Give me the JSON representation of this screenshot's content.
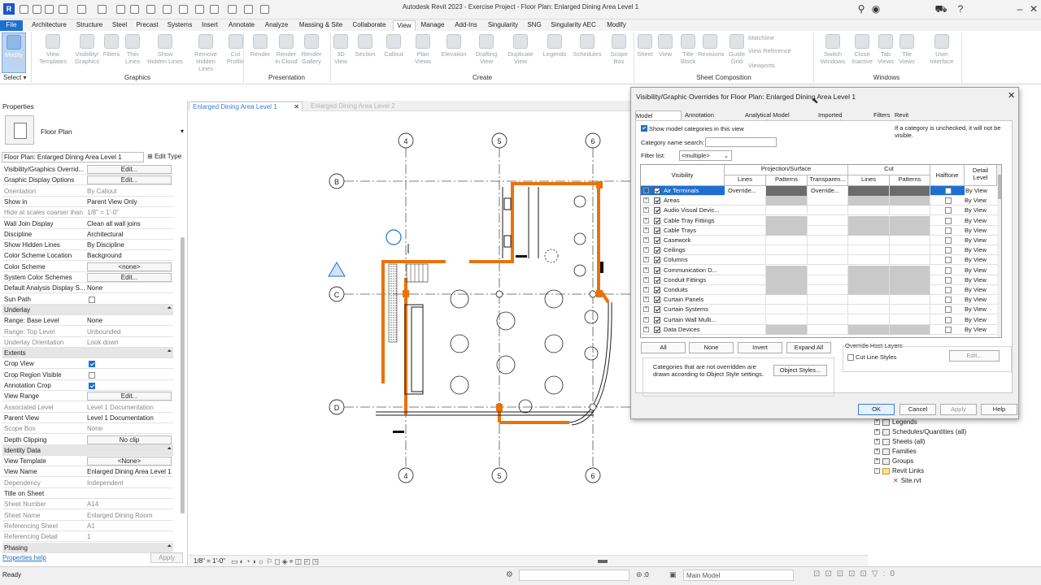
{
  "window": {
    "title": "Autodesk Revit 2023 - Exercise Project - Floor Plan: Enlarged Dining Area Level 1",
    "logo": "R"
  },
  "tabs": [
    "File",
    "Architecture",
    "Structure",
    "Steel",
    "Precast",
    "Systems",
    "Insert",
    "Annotate",
    "Analyze",
    "Massing & Site",
    "Collaborate",
    "View",
    "Manage",
    "Add-Ins",
    "Singularity",
    "SNG",
    "Singularity AEC",
    "Modify"
  ],
  "ribbon": {
    "buttons": [
      {
        "label": "Modify"
      },
      {
        "label": "View\nTemplates"
      },
      {
        "label": "Visibility/\nGraphics"
      },
      {
        "label": "Filters"
      },
      {
        "label": "Thin\nLines"
      },
      {
        "label": "Show\nHidden Lines"
      },
      {
        "label": "Remove\nHidden Lines"
      },
      {
        "label": "Cut\nProfile"
      },
      {
        "label": "Render"
      },
      {
        "label": "Render\nin Cloud"
      },
      {
        "label": "Render\nGallery"
      },
      {
        "label": "3D\nView"
      },
      {
        "label": "Section"
      },
      {
        "label": "Callout"
      },
      {
        "label": "Plan\nViews"
      },
      {
        "label": "Elevation"
      },
      {
        "label": "Drafting\nView"
      },
      {
        "label": "Duplicate\nView"
      },
      {
        "label": "Legends"
      },
      {
        "label": "Schedules"
      },
      {
        "label": "Scope\nBox"
      },
      {
        "label": "Sheet"
      },
      {
        "label": "View"
      },
      {
        "label": "Title\nBlock"
      },
      {
        "label": "Revisions"
      },
      {
        "label": "Guide\nGrid"
      },
      {
        "label": "Switch\nWindows"
      },
      {
        "label": "Close\nInactive"
      },
      {
        "label": "Tab\nViews"
      },
      {
        "label": "Tile\nViews"
      },
      {
        "label": "User\nInterface"
      }
    ],
    "small": [
      "Matchline",
      "View Reference",
      "Viewports"
    ],
    "groups": [
      "Select ▾",
      "Graphics",
      "Presentation",
      "Create",
      "Sheet Composition",
      "Windows"
    ]
  },
  "properties": {
    "header": "Properties",
    "type": "Floor Plan",
    "instance": "Floor Plan: Enlarged Dining Area Level 1",
    "edit_type": "Edit Type",
    "rows": [
      {
        "k": "Visibility/Graphics Overrid...",
        "v": "Edit...",
        "t": "btn"
      },
      {
        "k": "Graphic Display Options",
        "v": "Edit...",
        "t": "btn"
      },
      {
        "k": "Orientation",
        "v": "By Callout",
        "t": "gray"
      },
      {
        "k": "Show in",
        "v": "Parent View Only"
      },
      {
        "k": "Hide at scales coarser than",
        "v": "1/8\" = 1'-0\"",
        "t": "gray"
      },
      {
        "k": "Wall Join Display",
        "v": "Clean all wall joins"
      },
      {
        "k": "Discipline",
        "v": "Architectural"
      },
      {
        "k": "Show Hidden Lines",
        "v": "By Discipline"
      },
      {
        "k": "Color Scheme Location",
        "v": "Background"
      },
      {
        "k": "Color Scheme",
        "v": "<none>",
        "t": "btn"
      },
      {
        "k": "System Color Schemes",
        "v": "Edit...",
        "t": "btn"
      },
      {
        "k": "Default Analysis Display S...",
        "v": "None"
      },
      {
        "k": "Sun Path",
        "v": "",
        "t": "cb"
      },
      {
        "k": "Underlay",
        "v": "",
        "t": "sec"
      },
      {
        "k": "Range: Base Level",
        "v": "None"
      },
      {
        "k": "Range: Top Level",
        "v": "Unbounded",
        "t": "gray"
      },
      {
        "k": "Underlay Orientation",
        "v": "Look down",
        "t": "gray"
      },
      {
        "k": "Extents",
        "v": "",
        "t": "sec"
      },
      {
        "k": "Crop View",
        "v": "",
        "t": "cbon"
      },
      {
        "k": "Crop Region Visible",
        "v": "",
        "t": "cb"
      },
      {
        "k": "Annotation Crop",
        "v": "",
        "t": "cbon"
      },
      {
        "k": "View Range",
        "v": "Edit...",
        "t": "btn"
      },
      {
        "k": "Associated Level",
        "v": "Level 1 Documentation",
        "t": "gray"
      },
      {
        "k": "Parent View",
        "v": "Level 1 Documentation"
      },
      {
        "k": "Scope Box",
        "v": "None",
        "t": "gray"
      },
      {
        "k": "Depth Clipping",
        "v": "No clip",
        "t": "btn"
      },
      {
        "k": "Identity Data",
        "v": "",
        "t": "sec"
      },
      {
        "k": "View Template",
        "v": "<None>",
        "t": "btn"
      },
      {
        "k": "View Name",
        "v": "Enlarged Dining Area Level 1"
      },
      {
        "k": "Dependency",
        "v": "Independent",
        "t": "gray"
      },
      {
        "k": "Title on Sheet",
        "v": ""
      },
      {
        "k": "Sheet Number",
        "v": "A14",
        "t": "gray"
      },
      {
        "k": "Sheet Name",
        "v": "Enlarged Dining Room",
        "t": "gray"
      },
      {
        "k": "Referencing Sheet",
        "v": "A1",
        "t": "gray"
      },
      {
        "k": "Referencing Detail",
        "v": "1",
        "t": "gray"
      },
      {
        "k": "Phasing",
        "v": "",
        "t": "sec"
      }
    ],
    "help": "Properties help",
    "apply": "Apply"
  },
  "view_tabs": [
    "Enlarged Dining Area Level 1",
    "Enlarged Dining Area Level 2"
  ],
  "scale": "1/8\" = 1'-0\"",
  "grid": {
    "cols": [
      "4",
      "5",
      "6"
    ],
    "rows": [
      "B",
      "C",
      "D"
    ]
  },
  "browser": [
    "Legends",
    "Schedules/Quantities (all)",
    "Sheets (all)",
    "Families",
    "Groups",
    "Revit Links",
    "Site.rvt"
  ],
  "status": {
    "text": "Ready",
    "coord": ":0",
    "model": "Main Model"
  },
  "dialog": {
    "title": "Visibility/Graphic Overrides for Floor Plan: Enlarged Dining Area Level 1",
    "tabs": [
      "Model Categories",
      "Annotation Categories",
      "Analytical Model Categories",
      "Imported Categories",
      "Filters",
      "Revit Links"
    ],
    "show_label": "Show model categories in this view",
    "note": "If a category is unchecked, it will not be visible.",
    "search_label": "Category name search:",
    "filter_label": "Filter list:",
    "filter_value": "<multiple>",
    "headers": {
      "visibility": "Visibility",
      "proj": "Projection/Surface",
      "cut": "Cut",
      "lines": "Lines",
      "patterns": "Patterns",
      "transp": "Transparen...",
      "halftone": "Halftone",
      "detail": "Detail Level"
    },
    "rows": [
      "Air Terminals",
      "Areas",
      "Audio Visual Devic...",
      "Cable Tray Fittings",
      "Cable Trays",
      "Casework",
      "Ceilings",
      "Columns",
      "Communication D...",
      "Conduit Fittings",
      "Conduits",
      "Curtain Panels",
      "Curtain Systems",
      "Curtain Wall Mulli...",
      "Data Devices"
    ],
    "override": "Override...",
    "by_view": "By View",
    "buttons": {
      "all": "All",
      "none": "None",
      "invert": "Invert",
      "expand": "Expand All"
    },
    "host_title": "Override Host Layers",
    "cut_line": "Cut Line Styles",
    "host_edit": "Edit...",
    "info": "Categories that are not overridden are drawn according to Object Style settings.",
    "obj": "Object Styles...",
    "ok": "OK",
    "cancel": "Cancel",
    "apply": "Apply",
    "help": "Help"
  }
}
